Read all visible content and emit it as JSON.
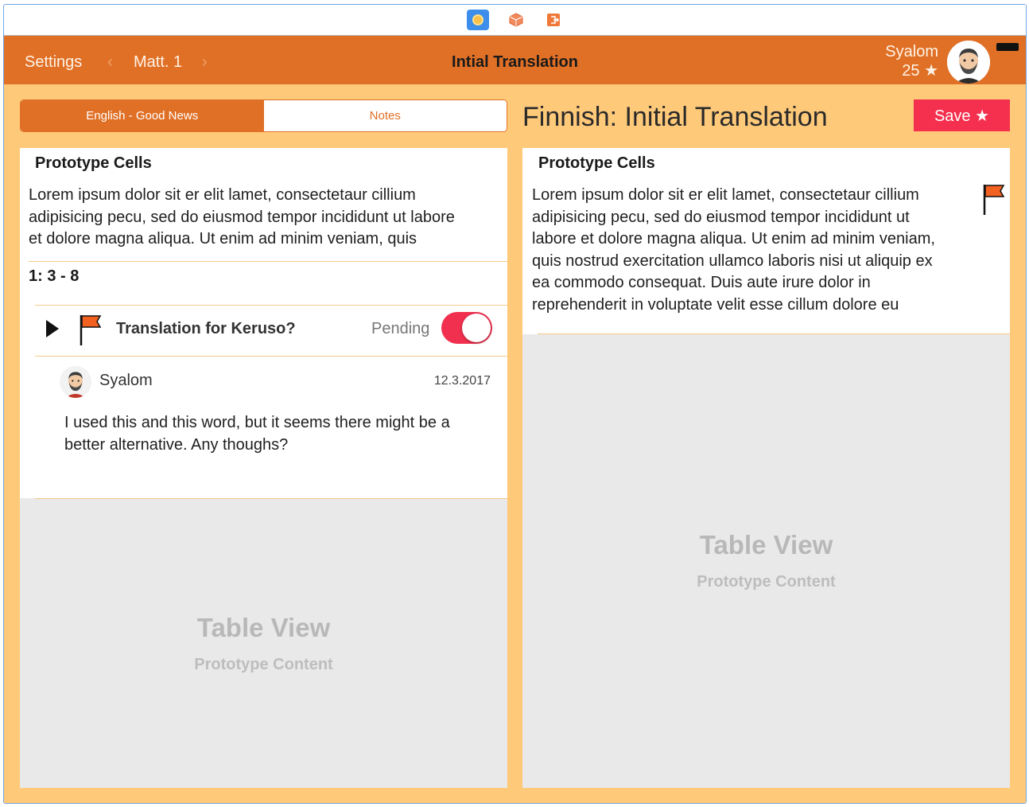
{
  "colors": {
    "nav_background": "#e07026",
    "screen_background": "#ffc97a",
    "accent_orange": "#e07026",
    "save_red": "#f52f4e",
    "toggle_on": "#f0304e",
    "flag": "#f2611f"
  },
  "dock": {
    "icons": [
      "view-controller-icon",
      "first-responder-icon",
      "exit-icon"
    ]
  },
  "navbar": {
    "settings_label": "Settings",
    "prev_icon": "‹",
    "chapter_label": "Matt. 1",
    "next_icon": "›",
    "title": "Intial Translation",
    "user_name": "Syalom",
    "user_points": "25 ★"
  },
  "left": {
    "segments": [
      "English - Good News",
      "Notes"
    ],
    "selected_segment": "English - Good News",
    "header": "Prototype Cells",
    "body_lines": [
      "Lorem ipsum dolor sit er elit lamet, consectetaur cillium",
      "adipisicing pecu, sed do eiusmod tempor incididunt ut labore",
      "et dolore magna aliqua. Ut enim ad minim veniam, quis"
    ],
    "verse_ref": "1: 3 - 8",
    "note": {
      "title": "Translation for Keruso?",
      "status": "Pending",
      "toggle_on": true
    },
    "comment": {
      "author": "Syalom",
      "date": "12.3.2017",
      "lines": [
        "I used this and this word, but it seems there might be a",
        "better alternative. Any thoughs?"
      ]
    },
    "placeholder": {
      "title": "Table View",
      "subtitle": "Prototype Content"
    }
  },
  "right": {
    "title": "Finnish: Initial Translation",
    "save_label": "Save ★",
    "header": "Prototype Cells",
    "body_lines": [
      "Lorem ipsum dolor sit er elit lamet, consectetaur cillium",
      "adipisicing pecu, sed do eiusmod tempor incididunt ut",
      "labore et dolore magna aliqua. Ut enim ad minim veniam,",
      "quis nostrud exercitation ullamco laboris nisi ut aliquip ex",
      "ea commodo consequat. Duis aute irure dolor in",
      "reprehenderit in voluptate velit esse cillum dolore eu"
    ],
    "placeholder": {
      "title": "Table View",
      "subtitle": "Prototype Content"
    }
  }
}
